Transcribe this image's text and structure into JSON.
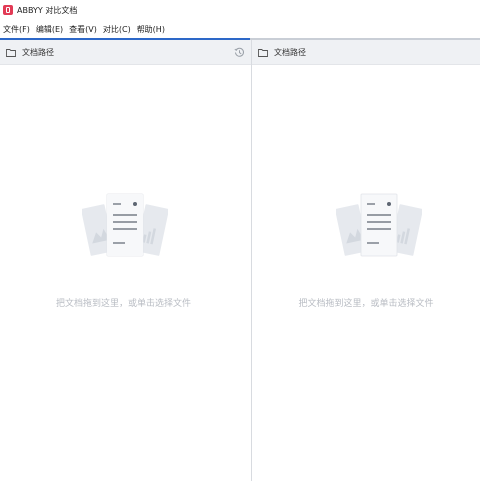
{
  "window": {
    "title": "ABBYY 对比文档"
  },
  "menubar": {
    "items": [
      {
        "label": "文件(F)"
      },
      {
        "label": "编辑(E)"
      },
      {
        "label": "查看(V)"
      },
      {
        "label": "对比(C)"
      },
      {
        "label": "帮助(H)"
      }
    ]
  },
  "left_pane": {
    "header_label": "文档路径",
    "drop_hint": "把文档拖到这里，或单击选择文件",
    "icons": [
      "folder-icon",
      "history-icon",
      "documents-illustration"
    ]
  },
  "right_pane": {
    "header_label": "文档路径",
    "drop_hint": "把文档拖到这里，或单击选择文件",
    "icons": [
      "folder-icon",
      "documents-illustration"
    ]
  },
  "colors": {
    "accent": "#2d68c8",
    "logo": "#e23a55",
    "header_bg": "#eff1f4",
    "hint_text": "#b8bcc3"
  }
}
